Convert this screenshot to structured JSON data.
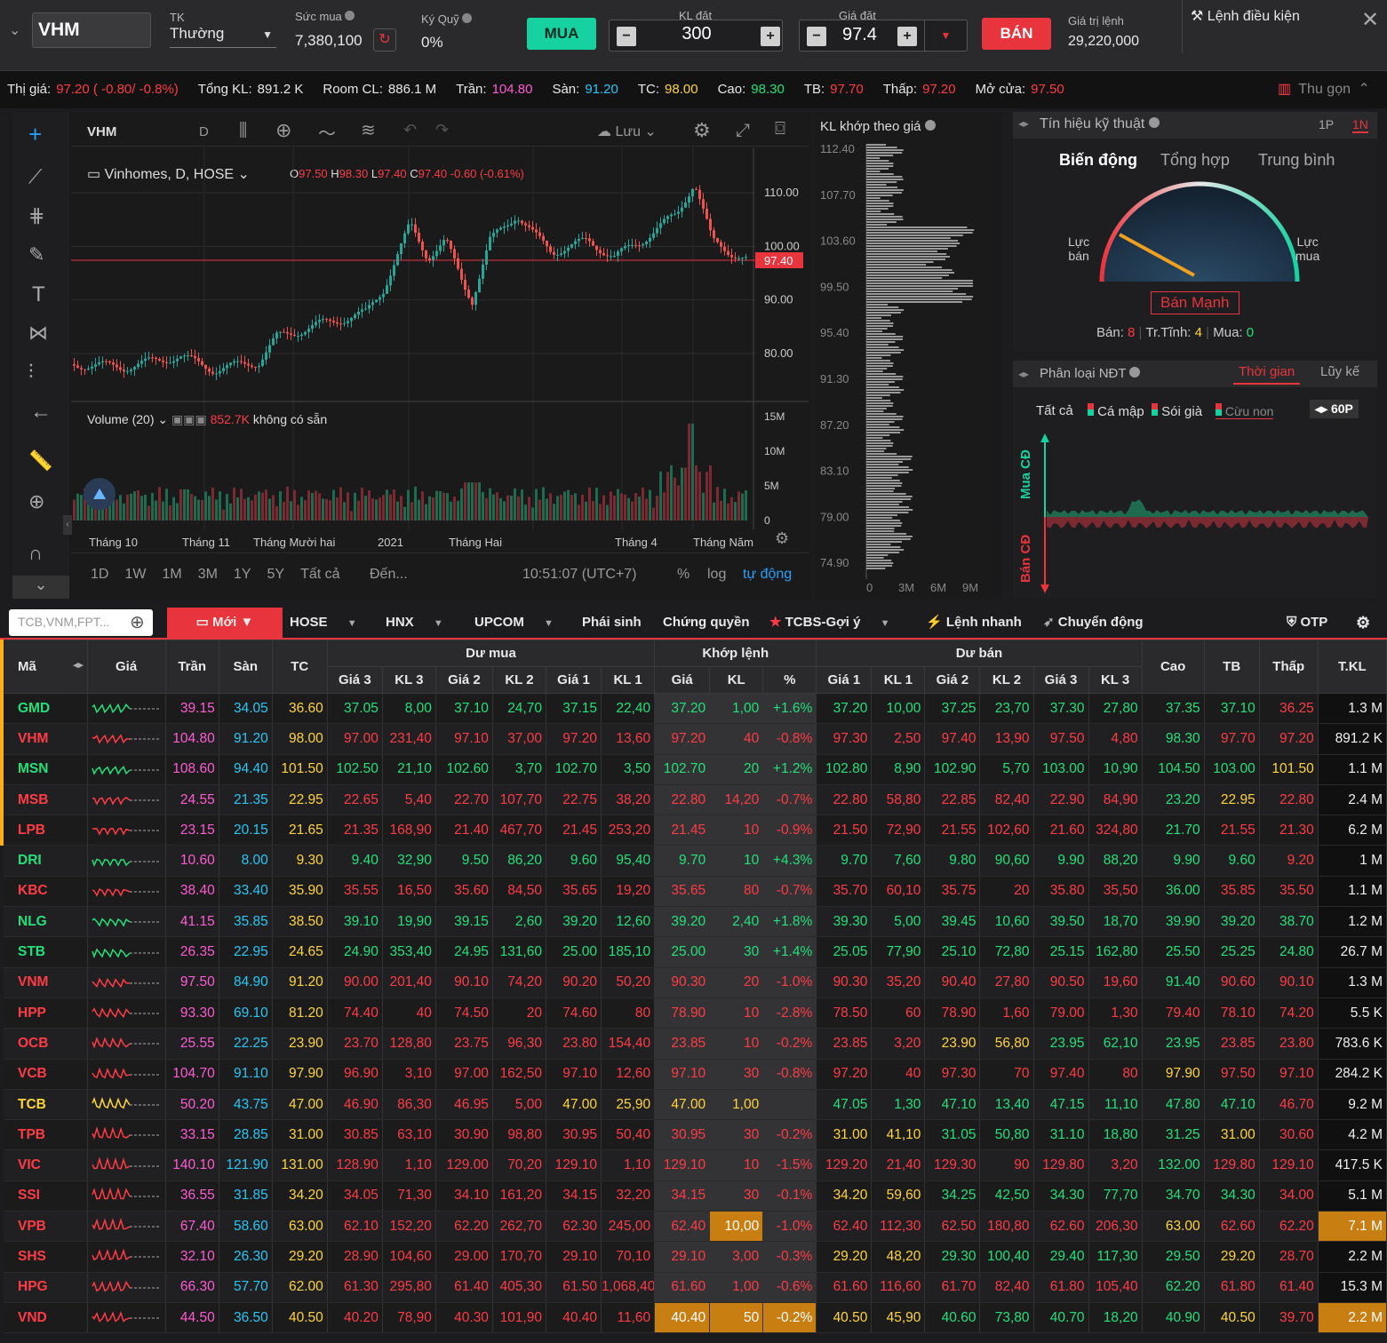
{
  "order": {
    "symbol": "VHM",
    "tk_label": "TK",
    "tk_value": "Thường",
    "sucmua_label": "Sức mua",
    "sucmua_value": "7,380,100",
    "kyquy_label": "Ký Quỹ",
    "kyquy_value": "0%",
    "buy": "MUA",
    "kl_label": "KL đặt",
    "kl_value": "300",
    "gia_label": "Giá đặt",
    "gia_value": "97.4",
    "sell": "BÁN",
    "gtl_label": "Giá trị lệnh",
    "gtl_value": "29,220,000",
    "cond": "Lệnh điều kiện"
  },
  "info": [
    {
      "k": "Thị giá:",
      "v": "97.20 ( -0.80/ -0.8%)",
      "c": "red"
    },
    {
      "k": "Tổng KL:",
      "v": "891.2 K",
      "c": "white"
    },
    {
      "k": "Room CL:",
      "v": "886.1 M",
      "c": "white"
    },
    {
      "k": "Trần:",
      "v": "104.80",
      "c": "pink"
    },
    {
      "k": "Sàn:",
      "v": "91.20",
      "c": "cyan"
    },
    {
      "k": "TC:",
      "v": "98.00",
      "c": "yellow"
    },
    {
      "k": "Cao:",
      "v": "98.30",
      "c": "green"
    },
    {
      "k": "TB:",
      "v": "97.70",
      "c": "red"
    },
    {
      "k": "Thấp:",
      "v": "97.20",
      "c": "red"
    },
    {
      "k": "Mở cửa:",
      "v": "97.50",
      "c": "red"
    }
  ],
  "collapse": "Thu gọn",
  "chart": {
    "sym": "VHM",
    "interval": "D",
    "save": "Lưu",
    "title": "Vinhomes, D, HOSE",
    "ohlc": {
      "o": "97.50",
      "h": "98.30",
      "l": "97.40",
      "c": "97.40",
      "chg": "-0.60 (-0.61%)"
    },
    "price_tag": "97.40",
    "volume_label": "Volume (20)",
    "volume_val": "852.7K",
    "volume_na": "không có sẵn",
    "yticks": [
      "110.00",
      "100.00",
      "90.00",
      "80.00"
    ],
    "vticks": [
      "15M",
      "10M",
      "5M",
      "0"
    ],
    "xticks": [
      "Tháng 10",
      "Tháng 11",
      "Tháng Mười hai",
      "2021",
      "Tháng Hai",
      "Tháng 4",
      "Tháng Năm"
    ],
    "ranges": [
      "1D",
      "1W",
      "1M",
      "3M",
      "1Y",
      "5Y",
      "Tất cả"
    ],
    "to": "Đến...",
    "time": "10:51:07 (UTC+7)",
    "pct": "%",
    "log": "log",
    "auto": "tự động"
  },
  "kl": {
    "title": "KL khớp theo giá",
    "yticks": [
      "112.40",
      "107.70",
      "103.60",
      "99.50",
      "95.40",
      "91.30",
      "87.20",
      "83.10",
      "79.00",
      "74.90"
    ],
    "xticks": [
      "0",
      "3M",
      "6M",
      "9M"
    ]
  },
  "sig": {
    "title": "Tín hiệu kỹ thuật",
    "p1": "1P",
    "p2": "1N",
    "tabs": [
      "Biến động",
      "Tổng hợp",
      "Trung bình"
    ],
    "left": "Lực\nbán",
    "right": "Lực\nmua",
    "verdict": "Bán Mạnh",
    "ban_label": "Bán:",
    "ban": "8",
    "trt_label": "Tr.Tĩnh:",
    "trt": "4",
    "mua_label": "Mua:",
    "mua": "0"
  },
  "ndt": {
    "title": "Phân loại NĐT",
    "t1": "Thời gian",
    "t2": "Lũy kế",
    "filters": [
      "Tất cả",
      "Cá mập",
      "Sói già",
      "Cừu non"
    ],
    "period": "60P",
    "buy_axis": "Mua CĐ",
    "sell_axis": "Bán CĐ"
  },
  "tabs": {
    "search_ph": "TCB,VNM,FPT...",
    "items": [
      "Mới",
      "HOSE",
      "HNX",
      "UPCOM",
      "Phái sinh",
      "Chứng quyền",
      "TCBS-Gợi ý",
      "Lệnh nhanh",
      "Chuyển động"
    ],
    "otp": "OTP"
  },
  "table": {
    "h1": {
      "ma": "Mã",
      "gia": "Giá",
      "tran": "Trần",
      "san": "Sàn",
      "tc": "TC",
      "dumua": "Dư mua",
      "khop": "Khớp lệnh",
      "duban": "Dư bán",
      "cao": "Cao",
      "tb": "TB",
      "thap": "Thấp",
      "tkl": "T.KL"
    },
    "h2": [
      "Giá 3",
      "KL 3",
      "Giá 2",
      "KL 2",
      "Giá 1",
      "KL 1",
      "Giá",
      "KL",
      "%",
      "Giá 1",
      "KL 1",
      "Giá 2",
      "KL 2",
      "Giá 3",
      "KL 3"
    ],
    "rows": [
      {
        "s": "GMD",
        "c": "g",
        "v": [
          "39.15",
          "34.05",
          "36.60",
          "37.05",
          "8,00",
          "37.10",
          "24,70",
          "37.15",
          "22,40",
          "37.20",
          "1,00",
          "+1.6%",
          "37.20",
          "10,00",
          "37.25",
          "23,70",
          "37.30",
          "27,80",
          "37.35",
          "37.10",
          "36.25",
          "1.3 M"
        ]
      },
      {
        "s": "VHM",
        "c": "r",
        "v": [
          "104.80",
          "91.20",
          "98.00",
          "97.00",
          "231,40",
          "97.10",
          "37,00",
          "97.20",
          "13,60",
          "97.20",
          "40",
          "-0.8%",
          "97.30",
          "2,50",
          "97.40",
          "13,90",
          "97.50",
          "4,80",
          "98.30",
          "97.70",
          "97.20",
          "891.2 K"
        ]
      },
      {
        "s": "MSN",
        "c": "g",
        "v": [
          "108.60",
          "94.40",
          "101.50",
          "102.50",
          "21,10",
          "102.60",
          "3,70",
          "102.70",
          "3,50",
          "102.70",
          "20",
          "+1.2%",
          "102.80",
          "8,90",
          "102.90",
          "5,70",
          "103.00",
          "10,90",
          "104.50",
          "103.00",
          "101.50",
          "1.1 M"
        ]
      },
      {
        "s": "MSB",
        "c": "r",
        "v": [
          "24.55",
          "21.35",
          "22.95",
          "22.65",
          "5,40",
          "22.70",
          "107,70",
          "22.75",
          "38,20",
          "22.80",
          "14,20",
          "-0.7%",
          "22.80",
          "58,80",
          "22.85",
          "82,40",
          "22.90",
          "84,90",
          "23.20",
          "22.95",
          "22.80",
          "2.4 M"
        ]
      },
      {
        "s": "LPB",
        "c": "r",
        "v": [
          "23.15",
          "20.15",
          "21.65",
          "21.35",
          "168,90",
          "21.40",
          "467,70",
          "21.45",
          "253,20",
          "21.45",
          "10",
          "-0.9%",
          "21.50",
          "72,90",
          "21.55",
          "102,60",
          "21.60",
          "324,80",
          "21.70",
          "21.55",
          "21.30",
          "6.2 M"
        ]
      },
      {
        "s": "DRI",
        "c": "g",
        "v": [
          "10.60",
          "8.00",
          "9.30",
          "9.40",
          "32,90",
          "9.50",
          "86,20",
          "9.60",
          "95,40",
          "9.70",
          "10",
          "+4.3%",
          "9.70",
          "7,60",
          "9.80",
          "90,60",
          "9.90",
          "88,20",
          "9.90",
          "9.60",
          "9.20",
          "1 M"
        ]
      },
      {
        "s": "KBC",
        "c": "r",
        "v": [
          "38.40",
          "33.40",
          "35.90",
          "35.55",
          "16,50",
          "35.60",
          "84,50",
          "35.65",
          "19,20",
          "35.65",
          "80",
          "-0.7%",
          "35.70",
          "60,10",
          "35.75",
          "20",
          "35.80",
          "35,50",
          "36.00",
          "35.85",
          "35.50",
          "1.1 M"
        ]
      },
      {
        "s": "NLG",
        "c": "g",
        "v": [
          "41.15",
          "35.85",
          "38.50",
          "39.10",
          "19,90",
          "39.15",
          "2,60",
          "39.20",
          "12,60",
          "39.20",
          "2,40",
          "+1.8%",
          "39.30",
          "5,00",
          "39.45",
          "10,60",
          "39.50",
          "18,70",
          "39.90",
          "39.20",
          "38.70",
          "1.2 M"
        ]
      },
      {
        "s": "STB",
        "c": "g",
        "v": [
          "26.35",
          "22.95",
          "24.65",
          "24.90",
          "353,40",
          "24.95",
          "131,60",
          "25.00",
          "185,10",
          "25.00",
          "30",
          "+1.4%",
          "25.05",
          "77,90",
          "25.10",
          "72,80",
          "25.15",
          "162,80",
          "25.50",
          "25.25",
          "24.80",
          "26.7 M"
        ]
      },
      {
        "s": "VNM",
        "c": "r",
        "v": [
          "97.50",
          "84.90",
          "91.20",
          "90.00",
          "201,40",
          "90.10",
          "74,20",
          "90.20",
          "50,20",
          "90.30",
          "20",
          "-1.0%",
          "90.30",
          "35,20",
          "90.40",
          "27,80",
          "90.50",
          "19,60",
          "91.40",
          "90.60",
          "90.10",
          "1.3 M"
        ]
      },
      {
        "s": "HPP",
        "c": "r",
        "v": [
          "93.30",
          "69.10",
          "81.20",
          "74.40",
          "40",
          "74.50",
          "20",
          "74.60",
          "80",
          "78.90",
          "10",
          "-2.8%",
          "78.50",
          "60",
          "78.90",
          "1,60",
          "79.00",
          "1,30",
          "79.40",
          "78.10",
          "74.20",
          "5.5 K"
        ]
      },
      {
        "s": "OCB",
        "c": "r",
        "v": [
          "25.55",
          "22.25",
          "23.90",
          "23.70",
          "128,80",
          "23.75",
          "96,30",
          "23.80",
          "154,40",
          "23.85",
          "10",
          "-0.2%",
          "23.85",
          "3,20",
          "23.90",
          "56,80",
          "23.95",
          "62,10",
          "23.95",
          "23.85",
          "23.80",
          "783.6 K"
        ]
      },
      {
        "s": "VCB",
        "c": "r",
        "v": [
          "104.70",
          "91.10",
          "97.90",
          "96.90",
          "3,10",
          "97.00",
          "162,50",
          "97.10",
          "12,60",
          "97.10",
          "30",
          "-0.8%",
          "97.20",
          "40",
          "97.30",
          "70",
          "97.40",
          "80",
          "97.90",
          "97.50",
          "97.10",
          "284.2 K"
        ]
      },
      {
        "s": "TCB",
        "c": "y",
        "v": [
          "50.20",
          "43.75",
          "47.00",
          "46.90",
          "86,30",
          "46.95",
          "5,00",
          "47.00",
          "25,90",
          "47.00",
          "1,00",
          "",
          "47.05",
          "1,30",
          "47.10",
          "13,40",
          "47.15",
          "11,10",
          "47.80",
          "47.10",
          "46.70",
          "9.2 M"
        ]
      },
      {
        "s": "TPB",
        "c": "r",
        "v": [
          "33.15",
          "28.85",
          "31.00",
          "30.85",
          "63,10",
          "30.90",
          "98,80",
          "30.95",
          "50,40",
          "30.95",
          "30",
          "-0.2%",
          "31.00",
          "41,10",
          "31.05",
          "50,80",
          "31.10",
          "18,80",
          "31.25",
          "31.00",
          "30.60",
          "4.2 M"
        ]
      },
      {
        "s": "VIC",
        "c": "r",
        "v": [
          "140.10",
          "121.90",
          "131.00",
          "128.90",
          "1,10",
          "129.00",
          "70,20",
          "129.10",
          "1,10",
          "129.10",
          "10",
          "-1.5%",
          "129.20",
          "21,40",
          "129.30",
          "90",
          "129.80",
          "3,20",
          "132.00",
          "129.80",
          "129.10",
          "417.5 K"
        ]
      },
      {
        "s": "SSI",
        "c": "r",
        "v": [
          "36.55",
          "31.85",
          "34.20",
          "34.05",
          "71,30",
          "34.10",
          "161,20",
          "34.15",
          "32,20",
          "34.15",
          "30",
          "-0.1%",
          "34.20",
          "59,60",
          "34.25",
          "42,50",
          "34.30",
          "77,70",
          "34.70",
          "34.30",
          "34.00",
          "5.1 M"
        ]
      },
      {
        "s": "VPB",
        "c": "r",
        "v": [
          "67.40",
          "58.60",
          "63.00",
          "62.10",
          "152,20",
          "62.20",
          "262,70",
          "62.30",
          "245,00",
          "62.40",
          "10,00",
          "-1.0%",
          "62.40",
          "112,30",
          "62.50",
          "180,80",
          "62.60",
          "206,30",
          "63.00",
          "62.60",
          "62.20",
          "7.1 M"
        ]
      },
      {
        "s": "SHS",
        "c": "r",
        "v": [
          "32.10",
          "26.30",
          "29.20",
          "28.90",
          "104,60",
          "29.00",
          "170,70",
          "29.10",
          "70,10",
          "29.10",
          "3,00",
          "-0.3%",
          "29.20",
          "48,20",
          "29.30",
          "100,40",
          "29.40",
          "117,30",
          "29.50",
          "29.20",
          "28.70",
          "2.2 M"
        ]
      },
      {
        "s": "HPG",
        "c": "r",
        "v": [
          "66.30",
          "57.70",
          "62.00",
          "61.30",
          "295,80",
          "61.40",
          "405,30",
          "61.50",
          "1,068,40",
          "61.60",
          "1,00",
          "-0.6%",
          "61.60",
          "116,60",
          "61.70",
          "82,40",
          "61.80",
          "105,40",
          "62.20",
          "61.80",
          "61.40",
          "15.3 M"
        ]
      },
      {
        "s": "VND",
        "c": "r",
        "v": [
          "44.50",
          "36.50",
          "40.50",
          "40.20",
          "78,90",
          "40.30",
          "101,90",
          "40.40",
          "11,60",
          "40.40",
          "50",
          "-0.2%",
          "40.50",
          "45,90",
          "40.60",
          "73,80",
          "40.70",
          "18,20",
          "40.90",
          "40.50",
          "39.70",
          "2.2 M"
        ]
      }
    ]
  },
  "colors": {
    "buy": "#16d1a0",
    "sell": "#e8343d",
    "green": "#22e07a",
    "red": "#ff3b45",
    "yellow": "#ffd43b",
    "cyan": "#28c7f5",
    "pink": "#ff5bd2",
    "highlight": "#c97e12"
  }
}
